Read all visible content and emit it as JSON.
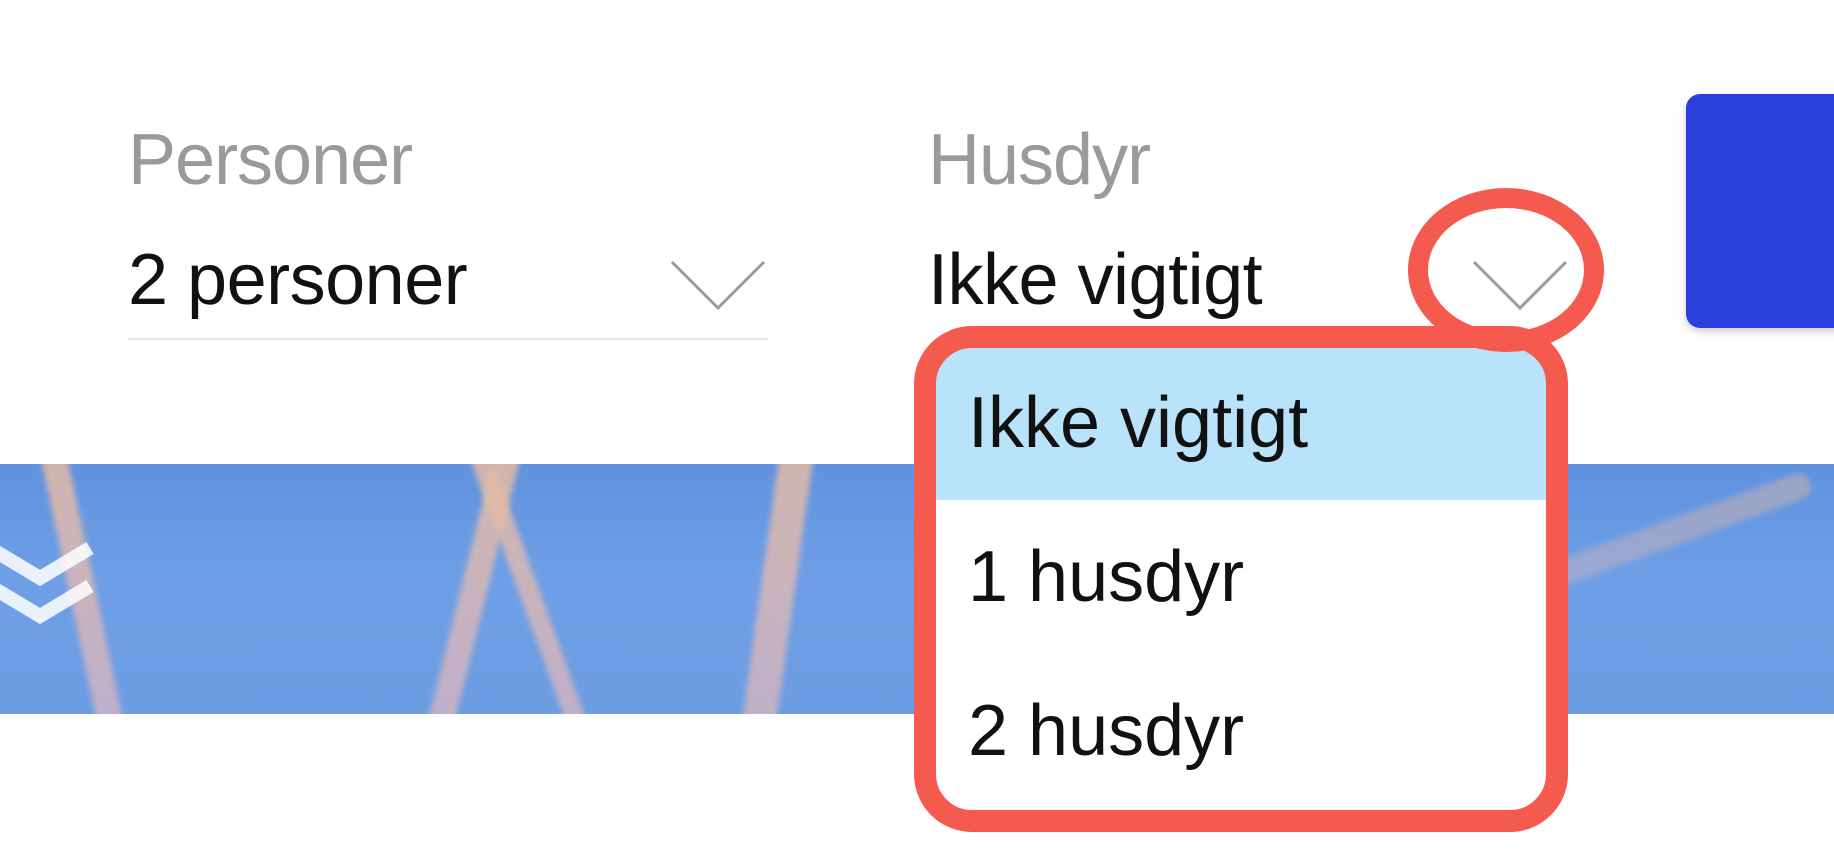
{
  "filters": {
    "persons": {
      "label": "Personer",
      "value": "2 personer",
      "icon": "chevron-down-icon"
    },
    "pets": {
      "label": "Husdyr",
      "value": "Ikke vigtigt",
      "icon": "chevron-down-icon",
      "expanded": true,
      "options": [
        {
          "label": "Ikke vigtigt",
          "selected": true
        },
        {
          "label": "1 husdyr",
          "selected": false
        },
        {
          "label": "2 husdyr",
          "selected": false
        }
      ]
    }
  },
  "search_button": {
    "color": "#2a3fdc"
  },
  "hero": {
    "scroll_icon": "double-chevron-down-icon"
  },
  "annotation": {
    "color": "#f55a4e"
  },
  "colors": {
    "label": "#9a9a9a",
    "value": "#111111",
    "selected_option": "#b9e2fb"
  }
}
